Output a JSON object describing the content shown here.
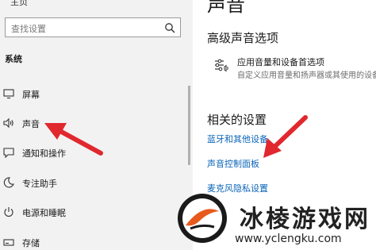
{
  "sidebar": {
    "home_label": "主页",
    "search_placeholder": "查找设置",
    "section_label": "系统",
    "items": [
      {
        "label": "屏幕",
        "icon": "monitor-icon"
      },
      {
        "label": "声音",
        "icon": "speaker-icon"
      },
      {
        "label": "通知和操作",
        "icon": "notification-icon"
      },
      {
        "label": "专注助手",
        "icon": "moon-icon"
      },
      {
        "label": "电源和睡眠",
        "icon": "power-icon"
      },
      {
        "label": "存储",
        "icon": "storage-icon"
      }
    ]
  },
  "main": {
    "page_title": "声音",
    "advanced_heading": "高级声音选项",
    "app_volume": {
      "title": "应用音量和设备首选项",
      "subtitle": "自定义应用音量和扬声器或其使用的设备。"
    },
    "related_heading": "相关的设置",
    "links": [
      "蓝牙和其他设备",
      "声音控制面板",
      "麦克风隐私设置"
    ]
  },
  "watermark": {
    "text": "冰棱游戏网",
    "url": "www.yclengku.com"
  },
  "colors": {
    "accent_link": "#0a64b8",
    "arrow": "#e0282e",
    "sidebar_bg": "#f2f2f2"
  }
}
